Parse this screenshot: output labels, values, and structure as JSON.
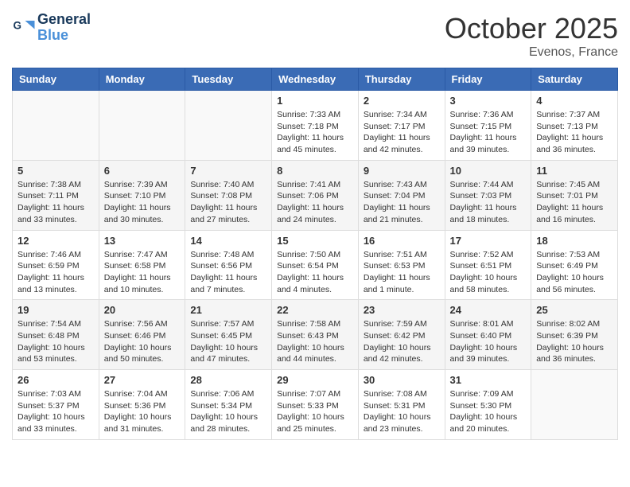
{
  "logo": {
    "line1": "General",
    "line2": "Blue"
  },
  "title": "October 2025",
  "subtitle": "Evenos, France",
  "weekdays": [
    "Sunday",
    "Monday",
    "Tuesday",
    "Wednesday",
    "Thursday",
    "Friday",
    "Saturday"
  ],
  "weeks": [
    [
      {
        "day": "",
        "info": ""
      },
      {
        "day": "",
        "info": ""
      },
      {
        "day": "",
        "info": ""
      },
      {
        "day": "1",
        "info": "Sunrise: 7:33 AM\nSunset: 7:18 PM\nDaylight: 11 hours and 45 minutes."
      },
      {
        "day": "2",
        "info": "Sunrise: 7:34 AM\nSunset: 7:17 PM\nDaylight: 11 hours and 42 minutes."
      },
      {
        "day": "3",
        "info": "Sunrise: 7:36 AM\nSunset: 7:15 PM\nDaylight: 11 hours and 39 minutes."
      },
      {
        "day": "4",
        "info": "Sunrise: 7:37 AM\nSunset: 7:13 PM\nDaylight: 11 hours and 36 minutes."
      }
    ],
    [
      {
        "day": "5",
        "info": "Sunrise: 7:38 AM\nSunset: 7:11 PM\nDaylight: 11 hours and 33 minutes."
      },
      {
        "day": "6",
        "info": "Sunrise: 7:39 AM\nSunset: 7:10 PM\nDaylight: 11 hours and 30 minutes."
      },
      {
        "day": "7",
        "info": "Sunrise: 7:40 AM\nSunset: 7:08 PM\nDaylight: 11 hours and 27 minutes."
      },
      {
        "day": "8",
        "info": "Sunrise: 7:41 AM\nSunset: 7:06 PM\nDaylight: 11 hours and 24 minutes."
      },
      {
        "day": "9",
        "info": "Sunrise: 7:43 AM\nSunset: 7:04 PM\nDaylight: 11 hours and 21 minutes."
      },
      {
        "day": "10",
        "info": "Sunrise: 7:44 AM\nSunset: 7:03 PM\nDaylight: 11 hours and 18 minutes."
      },
      {
        "day": "11",
        "info": "Sunrise: 7:45 AM\nSunset: 7:01 PM\nDaylight: 11 hours and 16 minutes."
      }
    ],
    [
      {
        "day": "12",
        "info": "Sunrise: 7:46 AM\nSunset: 6:59 PM\nDaylight: 11 hours and 13 minutes."
      },
      {
        "day": "13",
        "info": "Sunrise: 7:47 AM\nSunset: 6:58 PM\nDaylight: 11 hours and 10 minutes."
      },
      {
        "day": "14",
        "info": "Sunrise: 7:48 AM\nSunset: 6:56 PM\nDaylight: 11 hours and 7 minutes."
      },
      {
        "day": "15",
        "info": "Sunrise: 7:50 AM\nSunset: 6:54 PM\nDaylight: 11 hours and 4 minutes."
      },
      {
        "day": "16",
        "info": "Sunrise: 7:51 AM\nSunset: 6:53 PM\nDaylight: 11 hours and 1 minute."
      },
      {
        "day": "17",
        "info": "Sunrise: 7:52 AM\nSunset: 6:51 PM\nDaylight: 10 hours and 58 minutes."
      },
      {
        "day": "18",
        "info": "Sunrise: 7:53 AM\nSunset: 6:49 PM\nDaylight: 10 hours and 56 minutes."
      }
    ],
    [
      {
        "day": "19",
        "info": "Sunrise: 7:54 AM\nSunset: 6:48 PM\nDaylight: 10 hours and 53 minutes."
      },
      {
        "day": "20",
        "info": "Sunrise: 7:56 AM\nSunset: 6:46 PM\nDaylight: 10 hours and 50 minutes."
      },
      {
        "day": "21",
        "info": "Sunrise: 7:57 AM\nSunset: 6:45 PM\nDaylight: 10 hours and 47 minutes."
      },
      {
        "day": "22",
        "info": "Sunrise: 7:58 AM\nSunset: 6:43 PM\nDaylight: 10 hours and 44 minutes."
      },
      {
        "day": "23",
        "info": "Sunrise: 7:59 AM\nSunset: 6:42 PM\nDaylight: 10 hours and 42 minutes."
      },
      {
        "day": "24",
        "info": "Sunrise: 8:01 AM\nSunset: 6:40 PM\nDaylight: 10 hours and 39 minutes."
      },
      {
        "day": "25",
        "info": "Sunrise: 8:02 AM\nSunset: 6:39 PM\nDaylight: 10 hours and 36 minutes."
      }
    ],
    [
      {
        "day": "26",
        "info": "Sunrise: 7:03 AM\nSunset: 5:37 PM\nDaylight: 10 hours and 33 minutes."
      },
      {
        "day": "27",
        "info": "Sunrise: 7:04 AM\nSunset: 5:36 PM\nDaylight: 10 hours and 31 minutes."
      },
      {
        "day": "28",
        "info": "Sunrise: 7:06 AM\nSunset: 5:34 PM\nDaylight: 10 hours and 28 minutes."
      },
      {
        "day": "29",
        "info": "Sunrise: 7:07 AM\nSunset: 5:33 PM\nDaylight: 10 hours and 25 minutes."
      },
      {
        "day": "30",
        "info": "Sunrise: 7:08 AM\nSunset: 5:31 PM\nDaylight: 10 hours and 23 minutes."
      },
      {
        "day": "31",
        "info": "Sunrise: 7:09 AM\nSunset: 5:30 PM\nDaylight: 10 hours and 20 minutes."
      },
      {
        "day": "",
        "info": ""
      }
    ]
  ]
}
